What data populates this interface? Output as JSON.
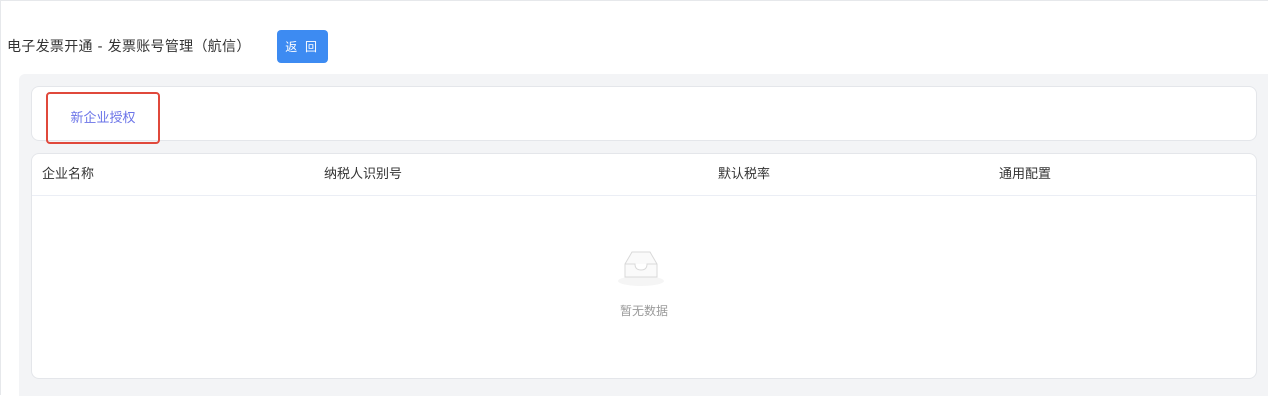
{
  "header": {
    "title": "电子发票开通 - 发票账号管理（航信）",
    "back_label": "返 回",
    "back_color": "#3d8bf2"
  },
  "toolbar": {
    "new_auth_label": "新企业授权",
    "highlight_color": "#e0483b"
  },
  "table": {
    "columns": [
      "企业名称",
      "纳税人识别号",
      "默认税率",
      "通用配置"
    ],
    "rows": [],
    "empty_text": "暂无数据",
    "empty_icon": "empty-inbox-icon"
  }
}
